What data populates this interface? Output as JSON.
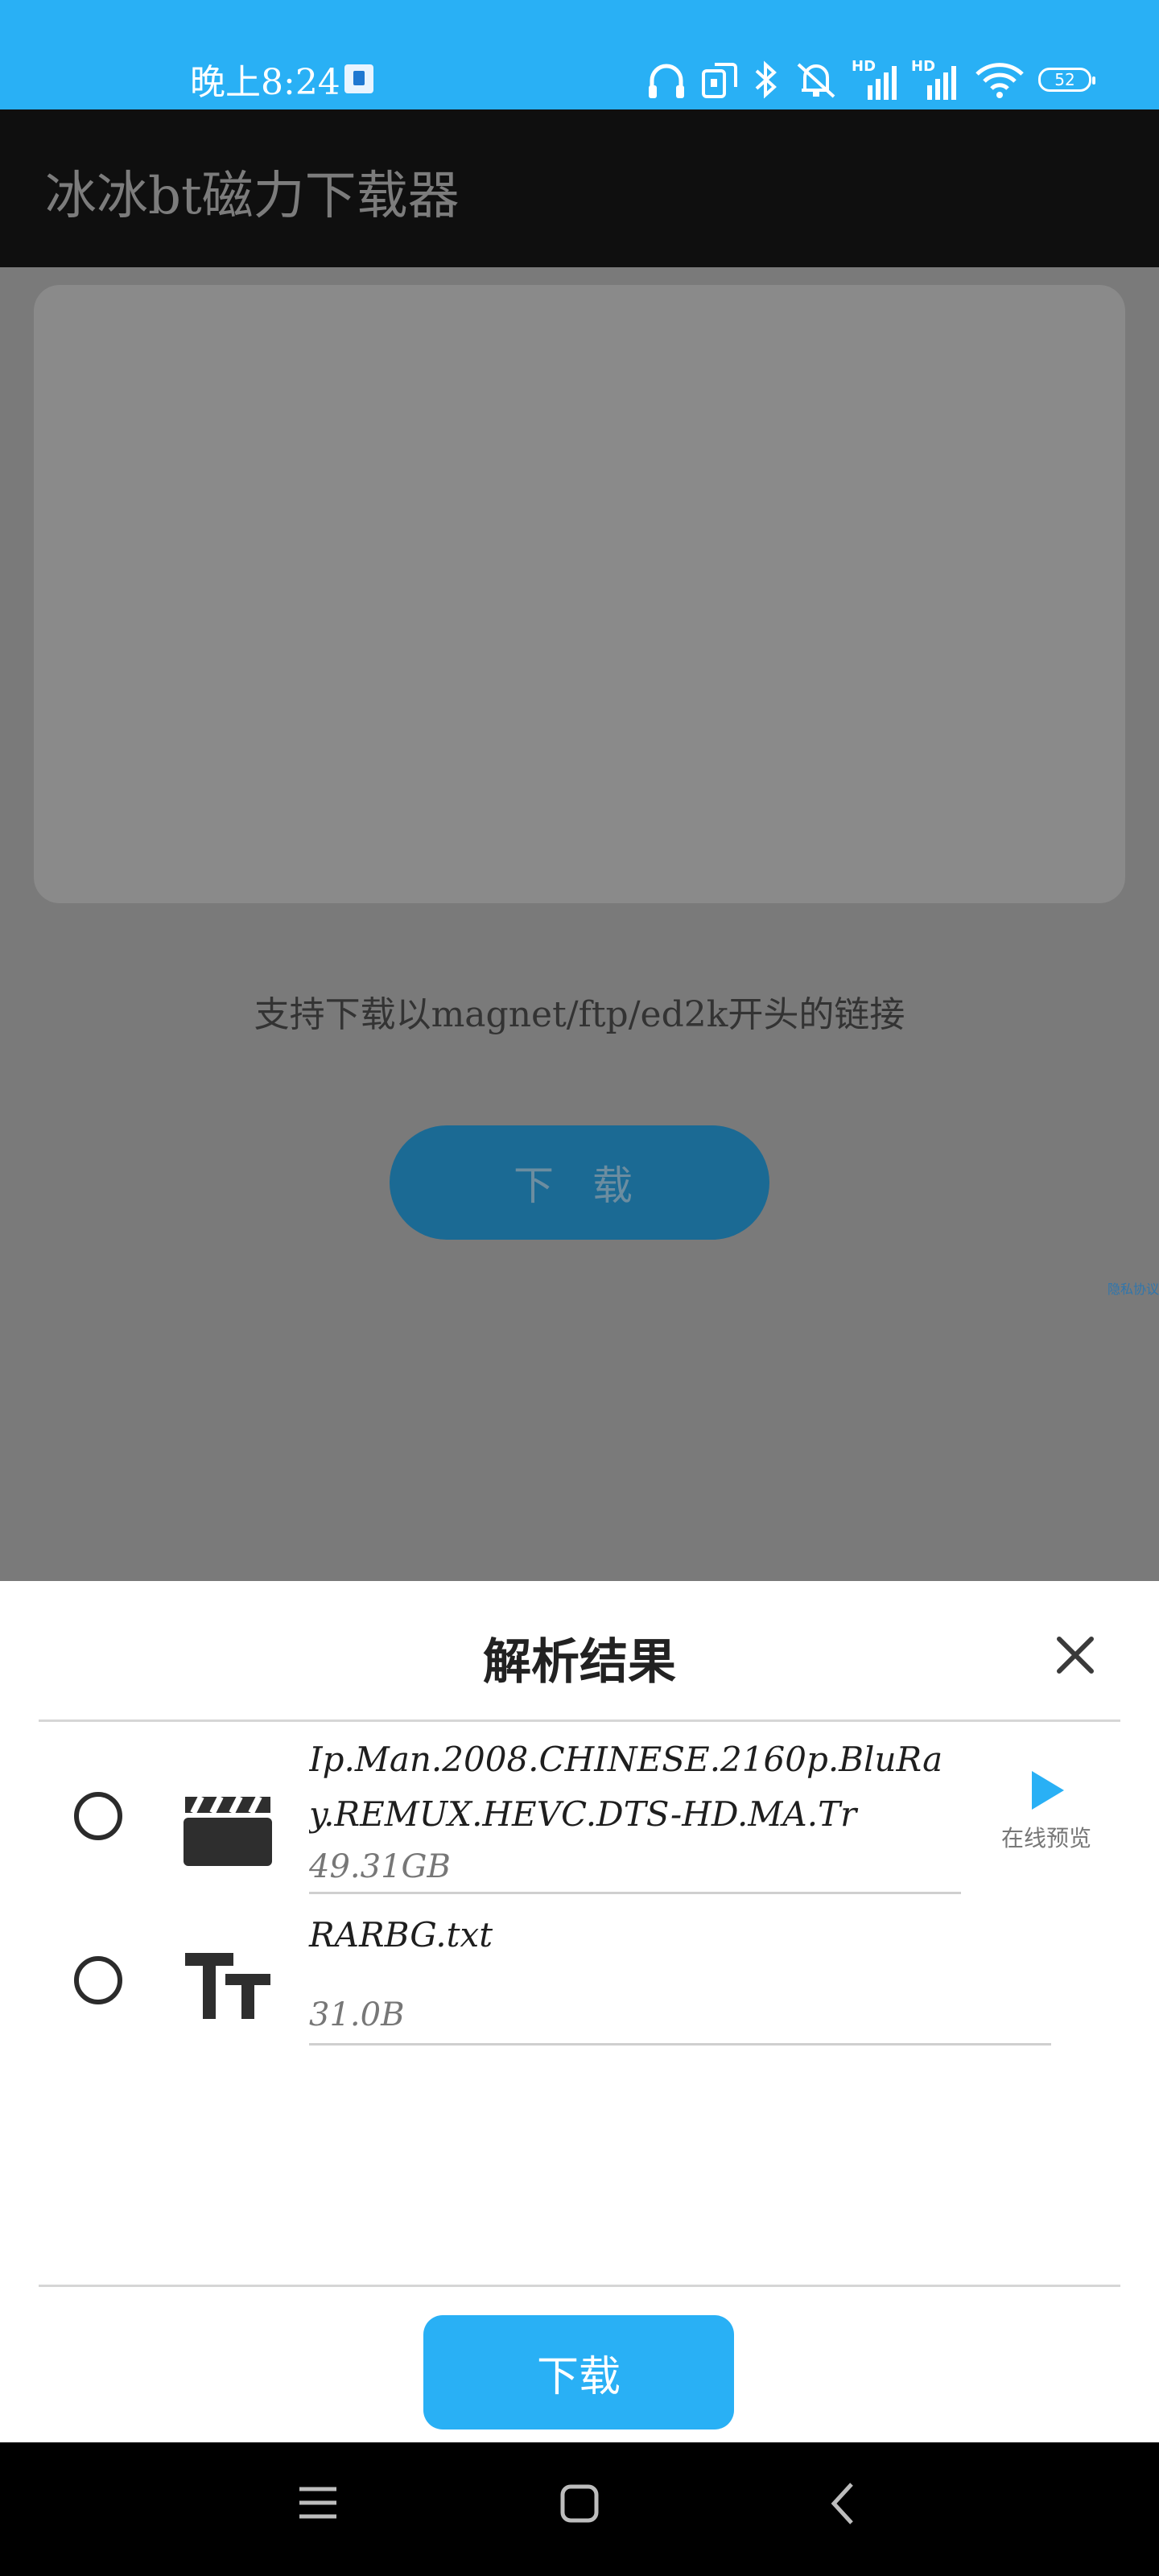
{
  "status_bar": {
    "time": "晚上8:24",
    "battery": "52",
    "icons": [
      "notification-app-icon",
      "headphones-icon",
      "screen-rotate-icon",
      "bluetooth-icon",
      "mute-icon",
      "hd-signal-icon",
      "hd-signal-icon",
      "wifi-icon",
      "battery-icon"
    ]
  },
  "app_bar": {
    "title": "冰冰bt磁力下载器"
  },
  "main": {
    "hint": "支持下载以magnet/ftp/ed2k开头的链接",
    "download_label": "下 载",
    "side_link": "隐私协议"
  },
  "sheet": {
    "title": "解析结果",
    "files": [
      {
        "name": "Ip.Man.2008.CHINESE.2160p.BluRay.REMUX.HEVC.DTS-HD.MA.Tr",
        "size": "49.31GB",
        "type": "video",
        "icon": "clapperboard-icon",
        "preview_label": "在线预览"
      },
      {
        "name": "RARBG.txt",
        "size": "31.0B",
        "type": "text",
        "icon": "text-icon"
      }
    ],
    "download_label": "下载"
  },
  "colors": {
    "accent": "#29b0f5",
    "appbar": "#0f0f0f"
  }
}
